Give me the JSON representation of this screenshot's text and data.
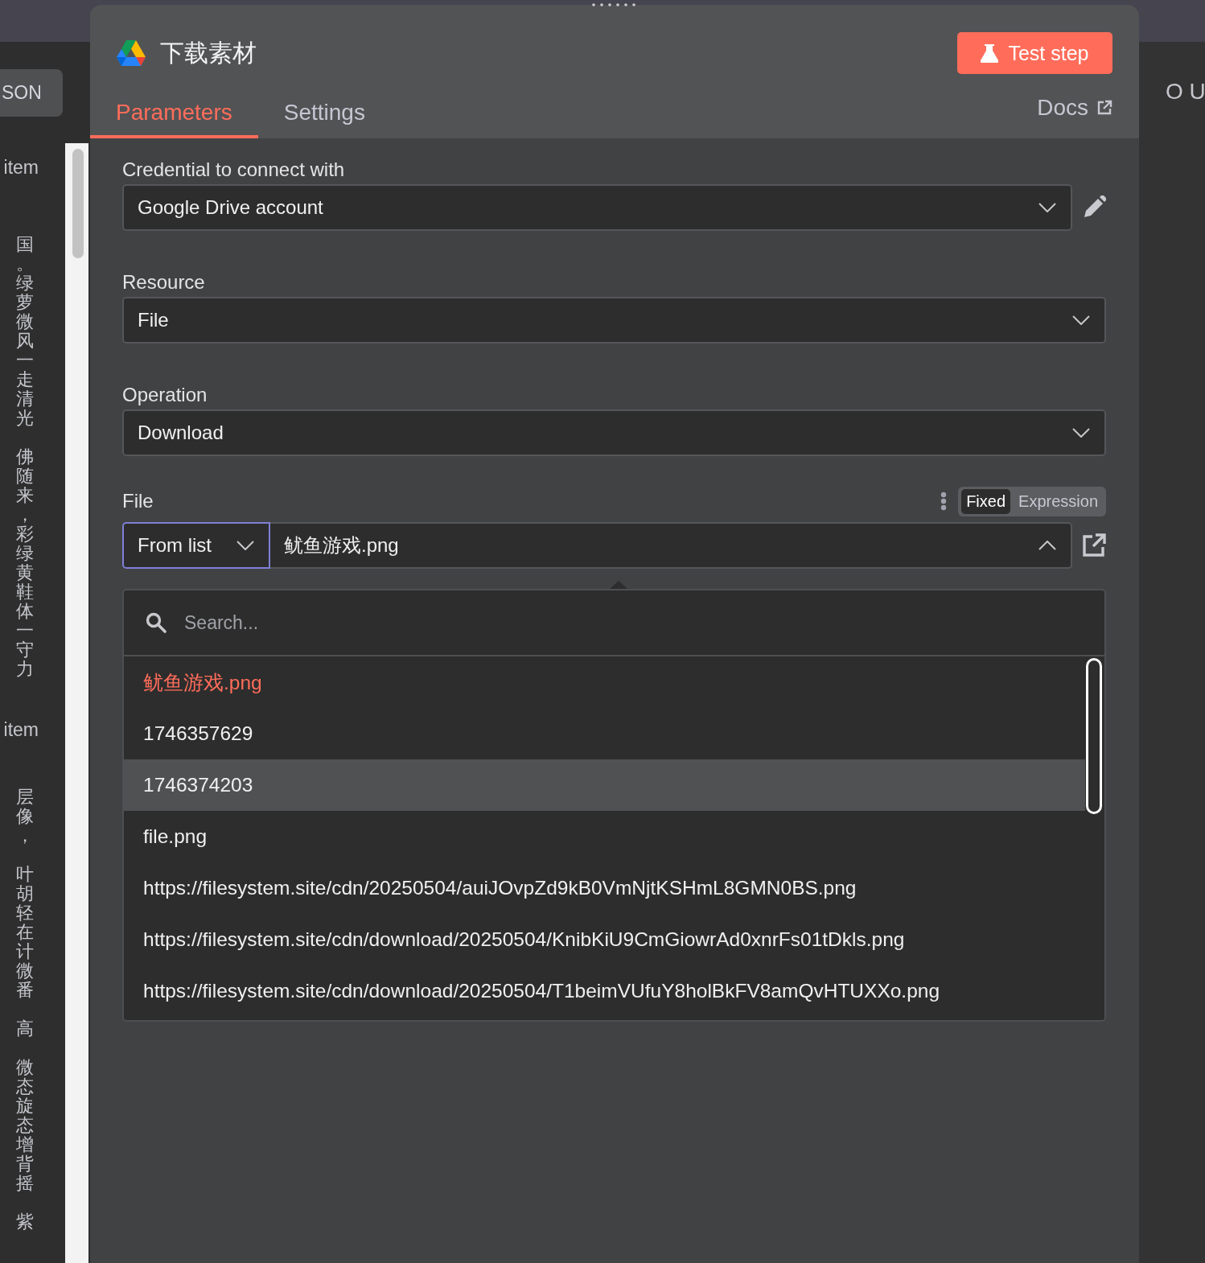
{
  "left_panel": {
    "button": "SON",
    "groups": [
      {
        "label": "item",
        "paragraphs": [
          [
            "国",
            "。",
            "绿",
            "萝",
            "微",
            "风",
            "一",
            "走",
            "清",
            "光"
          ],
          [
            "佛",
            "随",
            "来",
            "，",
            "彩",
            "绿",
            "黄",
            "鞋",
            "体",
            "一",
            "守",
            "力"
          ]
        ]
      },
      {
        "label": "item",
        "paragraphs": [
          [
            "层",
            "像",
            "，"
          ],
          [
            "叶",
            "胡",
            "轻",
            "在",
            "计",
            "微",
            "番"
          ],
          [
            "高"
          ],
          [
            "微",
            "态",
            "旋",
            "态",
            "增",
            "背",
            "摇"
          ],
          [
            "紫"
          ]
        ]
      }
    ]
  },
  "right_panel": {
    "label": "O U"
  },
  "node": {
    "title": "下载素材",
    "test_button": "Test step",
    "tabs": [
      {
        "label": "Parameters",
        "selected": true
      },
      {
        "label": "Settings",
        "selected": false
      }
    ],
    "docs_link": "Docs",
    "fields": [
      {
        "kind": "credential",
        "label": "Credential to connect with",
        "value": "Google Drive account"
      },
      {
        "kind": "select",
        "label": "Resource",
        "value": "File"
      },
      {
        "kind": "select",
        "label": "Operation",
        "value": "Download"
      },
      {
        "kind": "locator",
        "label": "File",
        "mode": "From list",
        "value": "鱿鱼游戏.png",
        "modes": [
          {
            "label": "Fixed",
            "selected": true
          },
          {
            "label": "Expression",
            "selected": false
          }
        ]
      }
    ],
    "dropdown": {
      "placeholder": "Search...",
      "items": [
        {
          "label": "鱿鱼游戏.png",
          "selected": true,
          "highlighted": false
        },
        {
          "label": "1746357629",
          "selected": false,
          "highlighted": false
        },
        {
          "label": "1746374203",
          "selected": false,
          "highlighted": true
        },
        {
          "label": "file.png",
          "selected": false,
          "highlighted": false
        },
        {
          "label": "https://filesystem.site/cdn/20250504/auiJOvpZd9kB0VmNjtKSHmL8GMN0BS.png",
          "selected": false,
          "highlighted": false
        },
        {
          "label": "https://filesystem.site/cdn/download/20250504/KnibKiU9CmGiowrAd0xnrFs01tDkls.png",
          "selected": false,
          "highlighted": false
        },
        {
          "label": "https://filesystem.site/cdn/download/20250504/T1beimVUfuY8holBkFV8amQvHTUXXo.png",
          "selected": false,
          "highlighted": false
        }
      ]
    }
  }
}
